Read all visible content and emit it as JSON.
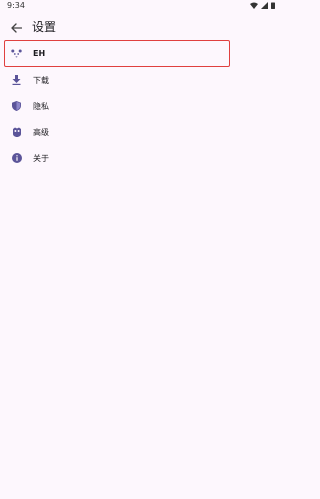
{
  "status_bar": {
    "time": "9:34"
  },
  "app_bar": {
    "title": "设置"
  },
  "menu": {
    "items": [
      {
        "label": "EH",
        "icon": "panda-icon"
      },
      {
        "label": "下载",
        "icon": "download-icon"
      },
      {
        "label": "隐私",
        "icon": "shield-icon"
      },
      {
        "label": "高级",
        "icon": "owl-icon"
      },
      {
        "label": "关于",
        "icon": "info-icon"
      }
    ]
  },
  "colors": {
    "background": "#fdf7fd",
    "icon_accent": "#5b5499",
    "highlight_border": "#e0403f"
  }
}
